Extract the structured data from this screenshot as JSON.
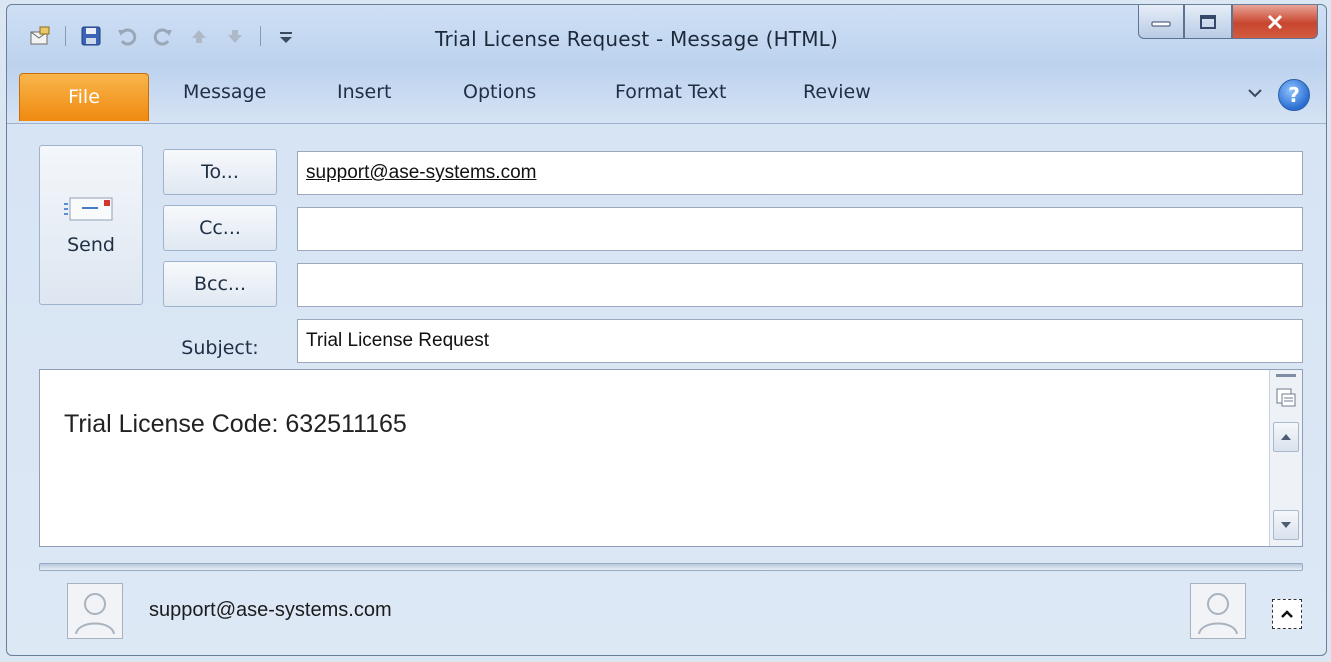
{
  "window": {
    "title": "Trial License Request  -  Message (HTML)"
  },
  "quick_access": {
    "icons": [
      "mail-icon",
      "save-icon",
      "undo-icon",
      "redo-icon",
      "up-arrow-icon",
      "down-arrow-icon",
      "customize-dropdown-icon"
    ]
  },
  "window_controls": [
    "minimize",
    "restore",
    "close"
  ],
  "ribbon": {
    "tabs": [
      "File",
      "Message",
      "Insert",
      "Options",
      "Format Text",
      "Review"
    ]
  },
  "header": {
    "send_label": "Send",
    "to_label": "To...",
    "cc_label": "Cc...",
    "bcc_label": "Bcc...",
    "subject_label": "Subject:",
    "to_value": "support@ase-systems.com",
    "cc_value": "",
    "bcc_value": "",
    "subject_value": "Trial License Request"
  },
  "body": {
    "text": "Trial License Code: 632511165"
  },
  "people_pane": {
    "contact": "support@ase-systems.com"
  }
}
